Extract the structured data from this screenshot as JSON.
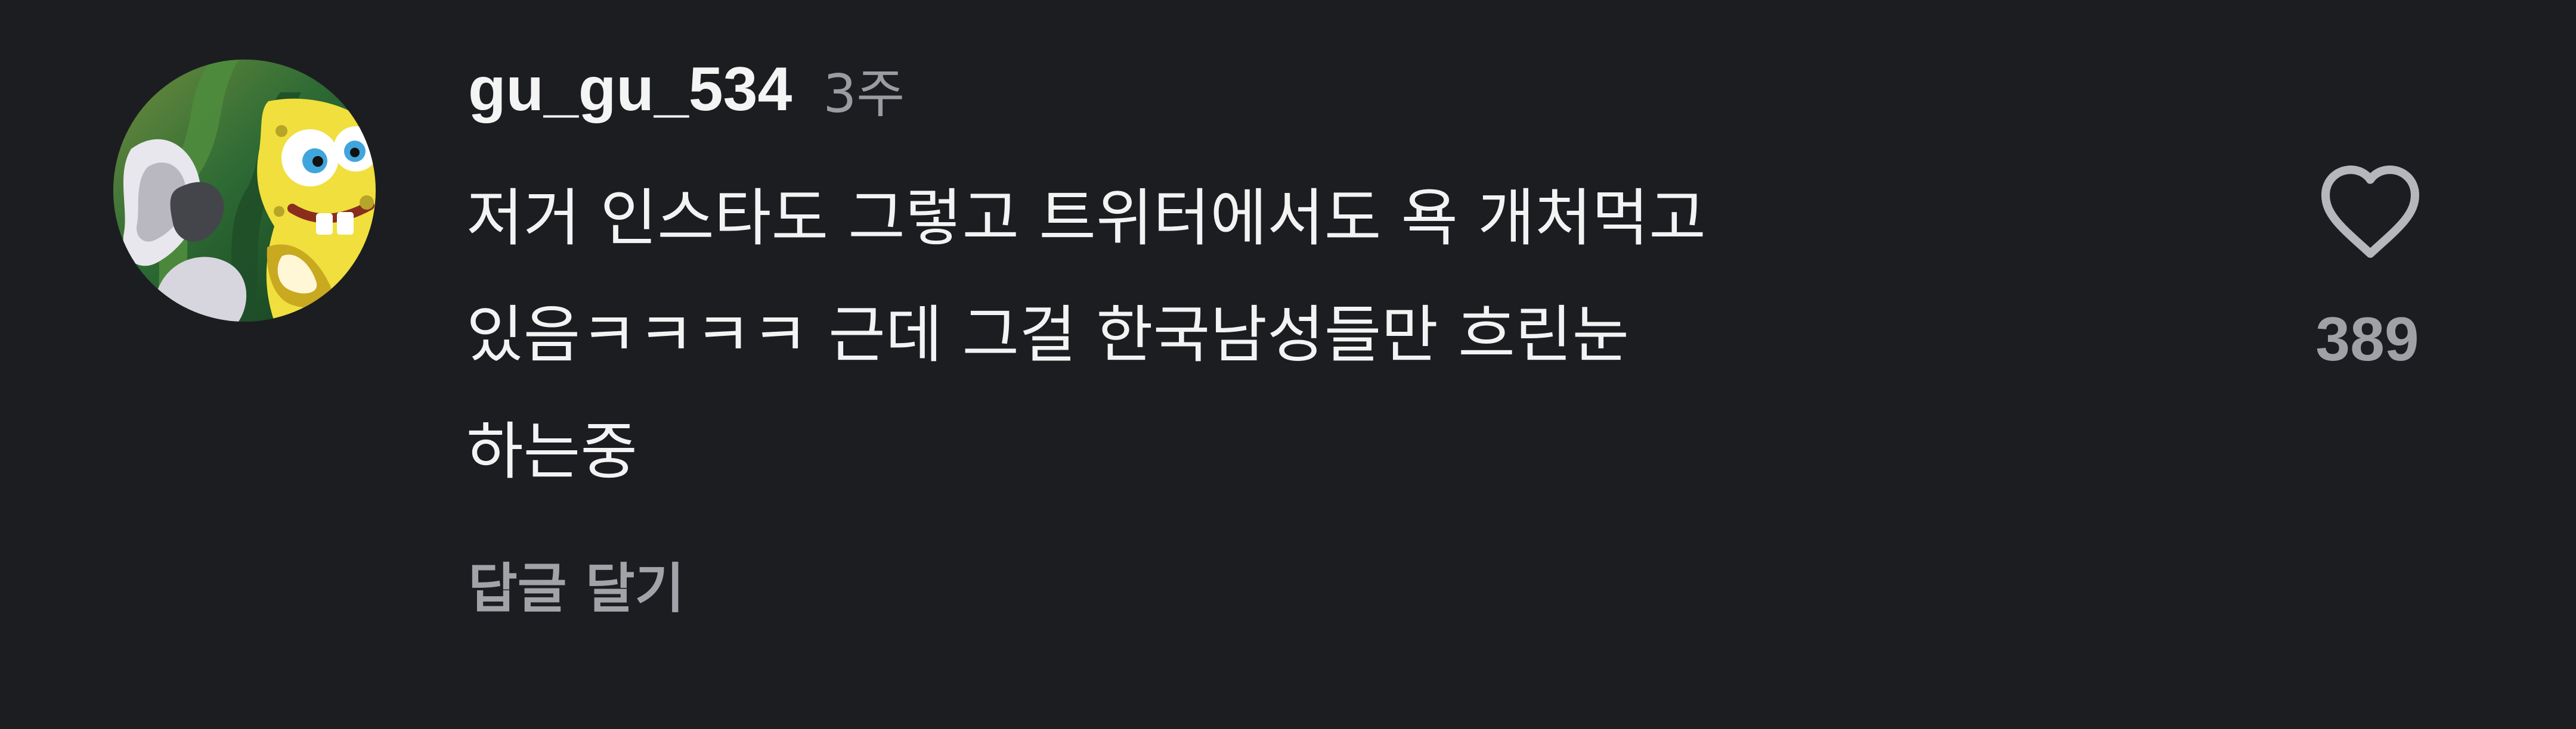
{
  "comment": {
    "username": "gu_gu_534",
    "timestamp": "3주",
    "text": "저거 인스타도 그렇고 트위터에서도 욕 개처먹고\n있음ㅋㅋㅋㅋ 근데 그걸 한국남성들만 흐린눈\n하는중",
    "reply_label": "답글 달기",
    "like_count": "389",
    "avatar_icon": "profile-avatar",
    "like_icon": "heart-outline-icon"
  },
  "colors": {
    "background": "#1c1d21",
    "primary_text": "#f3f3f3",
    "secondary_text": "#9b9ca2"
  }
}
